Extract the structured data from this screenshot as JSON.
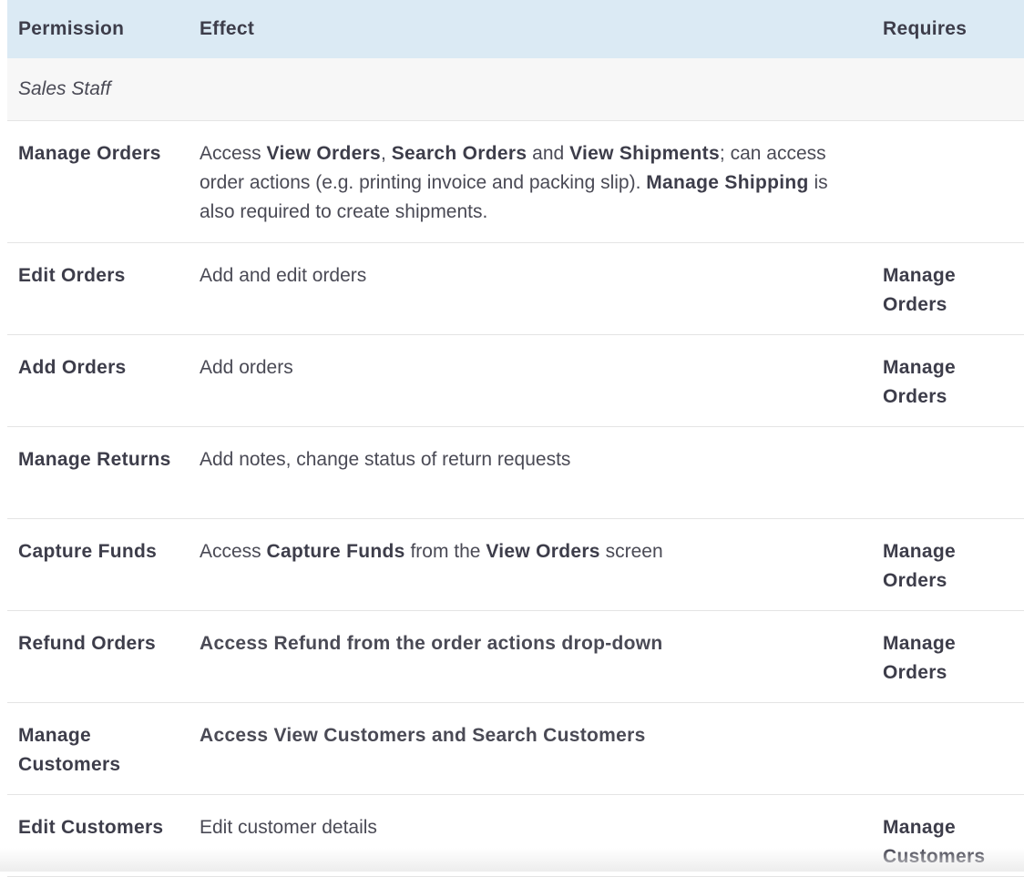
{
  "header": {
    "permission": "Permission",
    "effect": "Effect",
    "requires": "Requires"
  },
  "section": {
    "label": "Sales Staff"
  },
  "rows": [
    {
      "permission": "Manage Orders",
      "effect": {
        "p1": "Access ",
        "b1": "View Orders",
        "p2": ", ",
        "b2": "Search Orders",
        "p3": " and ",
        "b3": "View Shipments",
        "p4": "; can access order actions (e.g. printing invoice and packing slip). ",
        "b4": "Manage Shipping",
        "p5": " is also required to create shipments."
      },
      "requires": ""
    },
    {
      "permission": "Edit Orders",
      "effect": "Add and edit orders",
      "requires": "Manage Orders"
    },
    {
      "permission": "Add Orders",
      "effect": "Add orders",
      "requires": "Manage Orders"
    },
    {
      "permission": "Manage Returns",
      "effect": "Add notes, change status of return requests",
      "requires": ""
    },
    {
      "permission": "Capture Funds",
      "effect": {
        "p1": "Access ",
        "b1": "Capture Funds",
        "p2": " from the ",
        "b2": "View Orders",
        "p3": " screen"
      },
      "requires": "Manage Orders"
    },
    {
      "permission": "Refund Orders",
      "effect": "Access Refund from the order actions drop-down",
      "requires": "Manage Orders"
    },
    {
      "permission": "Manage Customers",
      "effect": "Access View Customers and Search Customers",
      "requires": ""
    },
    {
      "permission": "Edit Customers",
      "effect": "Edit customer details",
      "requires": "Manage Customers"
    }
  ]
}
